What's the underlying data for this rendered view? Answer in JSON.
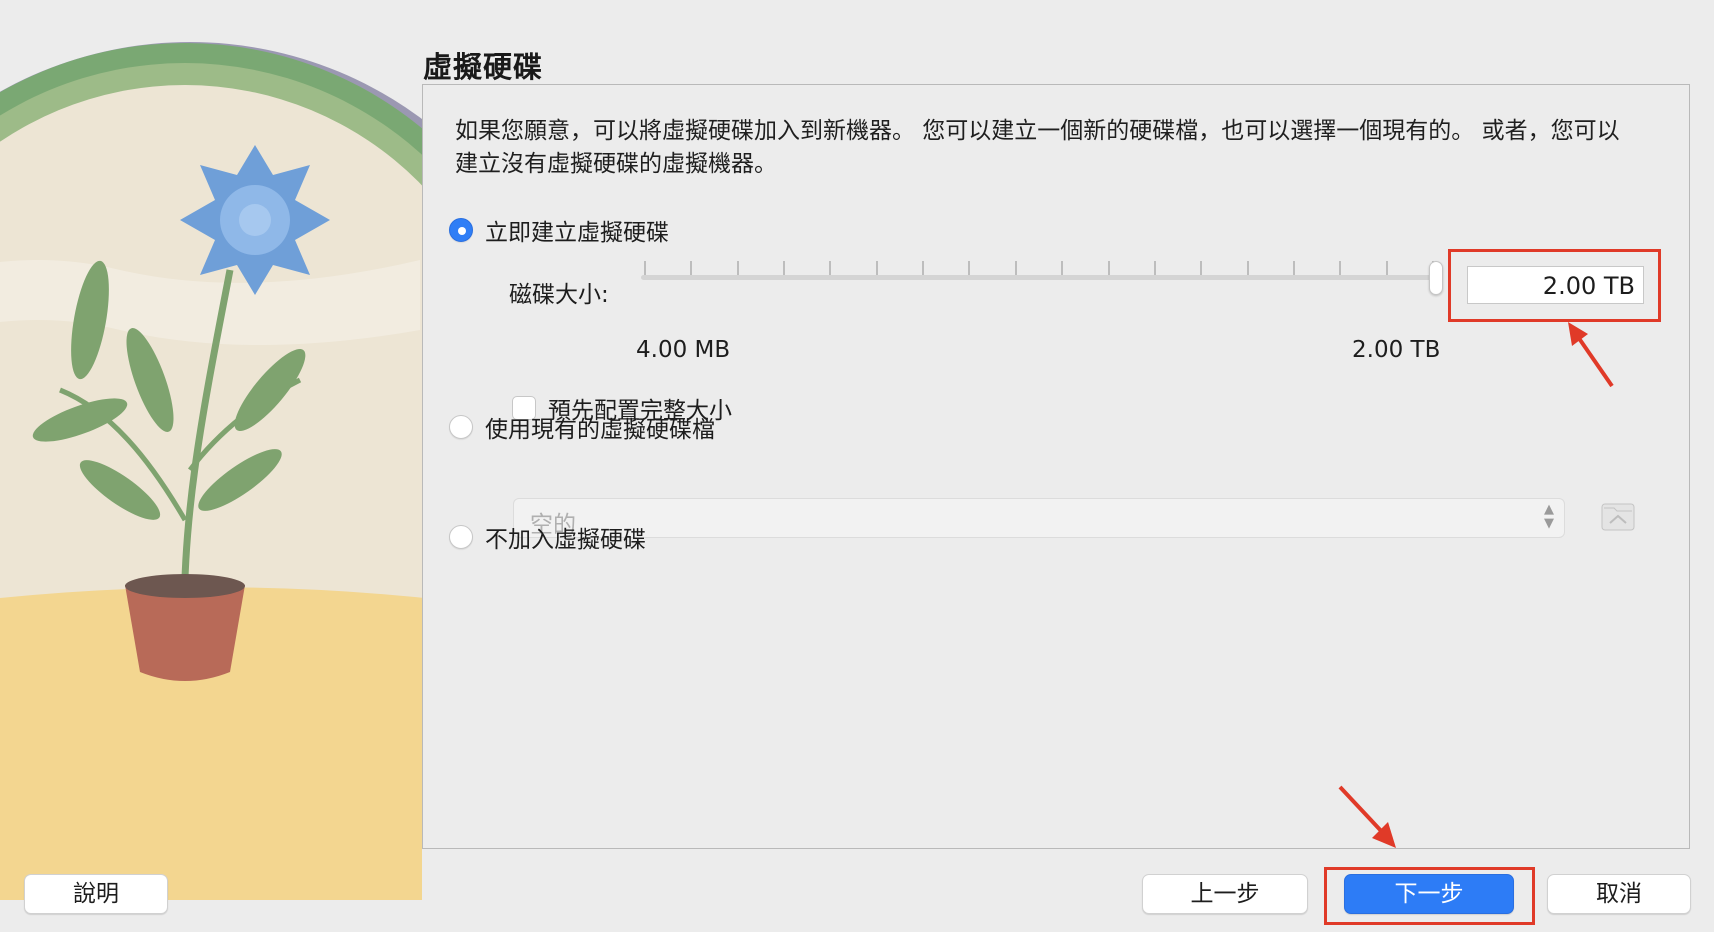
{
  "panel": {
    "title": "虛擬硬碟",
    "description": "如果您願意，可以將虛擬硬碟加入到新機器。 您可以建立一個新的硬碟檔，也可以選擇一個現有的。 或者，您可以建立沒有虛擬硬碟的虛擬機器。"
  },
  "options": {
    "create_now": {
      "label": "立即建立虛擬硬碟",
      "selected": true
    },
    "use_existing": {
      "label": "使用現有的虛擬硬碟檔",
      "selected": false
    },
    "no_disk": {
      "label": "不加入虛擬硬碟",
      "selected": false
    }
  },
  "disk_size": {
    "label": "磁碟大小:",
    "value": "2.00 TB",
    "min_label": "4.00 MB",
    "max_label": "2.00 TB",
    "slider_fraction": 1.0
  },
  "preallocate": {
    "label": "預先配置完整大小",
    "checked": false
  },
  "existing_file_select": {
    "value": "空的"
  },
  "buttons": {
    "help": "說明",
    "back": "上一步",
    "next": "下一步",
    "cancel": "取消"
  },
  "colors": {
    "accent": "#2d7cf6",
    "annotation": "#e03a28",
    "background": "#ececec"
  },
  "icons": {
    "folder": "folder-icon",
    "updown": "chevron-updown-icon"
  }
}
